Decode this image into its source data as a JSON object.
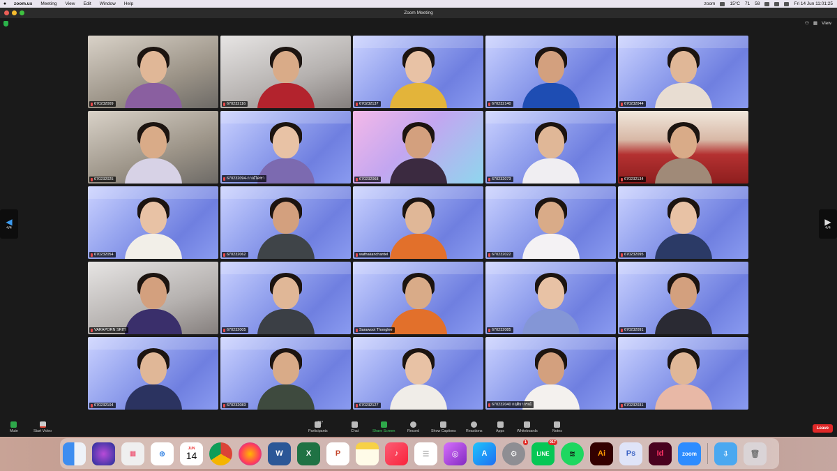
{
  "menubar": {
    "app": "zoom.us",
    "items": [
      "Meeting",
      "View",
      "Edit",
      "Window",
      "Help"
    ],
    "status": {
      "zoom": "zoom",
      "cpu": "15°C",
      "battery": "71",
      "net": "58",
      "clock": "Fri 14 Jun  11:01:25"
    }
  },
  "window": {
    "title": "Zoom Meeting",
    "view_label": "View"
  },
  "pager": {
    "left": "4/4",
    "right": "4/4"
  },
  "tiles": [
    {
      "name": "670232009",
      "bg": "room",
      "shirt": "#8a5fa0",
      "edu": false
    },
    {
      "name": "670232116",
      "bg": "room2",
      "shirt": "#b3232d",
      "edu": false
    },
    {
      "name": "670232137",
      "bg": "vbg",
      "shirt": "#e3b43a",
      "edu": true
    },
    {
      "name": "670232140",
      "bg": "vbg",
      "shirt": "#1e4db3",
      "edu": true
    },
    {
      "name": "670232044",
      "bg": "vbg",
      "shirt": "#e8ddd2",
      "edu": true
    },
    {
      "name": "670232025",
      "bg": "room",
      "shirt": "#d7d2e6",
      "edu": false
    },
    {
      "name": "670232094-กาณ์ไดซา",
      "bg": "vbg",
      "shirt": "#7c6ab0",
      "edu": true
    },
    {
      "name": "670232068",
      "bg": "pink",
      "shirt": "#3b2a40",
      "edu": false
    },
    {
      "name": "670232073",
      "bg": "vbg",
      "shirt": "#f0eef2",
      "edu": true
    },
    {
      "name": "670232134",
      "bg": "stage",
      "shirt": "#a08a78",
      "edu": false
    },
    {
      "name": "670232054",
      "bg": "vbg",
      "shirt": "#f2efe8",
      "edu": true
    },
    {
      "name": "670232062",
      "bg": "vbg",
      "shirt": "#3f4448",
      "edu": true
    },
    {
      "name": "wathakanchantel",
      "bg": "vbg",
      "shirt": "#e2702b",
      "edu": true
    },
    {
      "name": "670232022",
      "bg": "vbg",
      "shirt": "#f4f2f4",
      "edu": true
    },
    {
      "name": "670232095",
      "bg": "vbg",
      "shirt": "#2b3a66",
      "edu": true
    },
    {
      "name": "VARAPORN SRITI",
      "bg": "room2",
      "shirt": "#3a2f6b",
      "edu": false
    },
    {
      "name": "670232005",
      "bg": "vbg",
      "shirt": "#3b3f45",
      "edu": true
    },
    {
      "name": "Sarawoot Thonglee",
      "bg": "vbg",
      "shirt": "#e2702b",
      "edu": true
    },
    {
      "name": "670232085",
      "bg": "vbg",
      "shirt": "#8496d6",
      "edu": true
    },
    {
      "name": "670232091",
      "bg": "vbg",
      "shirt": "#2a2a33",
      "edu": true
    },
    {
      "name": "670232104",
      "bg": "vbg",
      "shirt": "#2b3360",
      "edu": true
    },
    {
      "name": "670232083",
      "bg": "vbg",
      "shirt": "#3e4a3e",
      "edu": true
    },
    {
      "name": "670232127",
      "bg": "vbg",
      "shirt": "#f0ede8",
      "edu": true
    },
    {
      "name": "670232040 กฤติยากรณ์",
      "bg": "vbg",
      "shirt": "#f4f1ee",
      "edu": true
    },
    {
      "name": "670232031",
      "bg": "vbg",
      "shirt": "#e8b8a6",
      "edu": true
    }
  ],
  "toolbar": {
    "mute": "Mute",
    "start_video": "Start Video",
    "participants": "Participants",
    "participants_count": "127",
    "chat": "Chat",
    "share": "Share Screen",
    "record": "Record",
    "captions": "Show Captions",
    "reactions": "Reactions",
    "apps": "Apps",
    "whiteboards": "Whiteboards",
    "notes": "Notes",
    "leave": "Leave"
  },
  "dock": {
    "calendar_month": "JUN",
    "calendar_day": "14",
    "line_badge": "917",
    "settings_badge": "1",
    "zoom_label": "zoom"
  },
  "colors": {
    "leave": "#e02828",
    "share": "#2ea84a"
  }
}
